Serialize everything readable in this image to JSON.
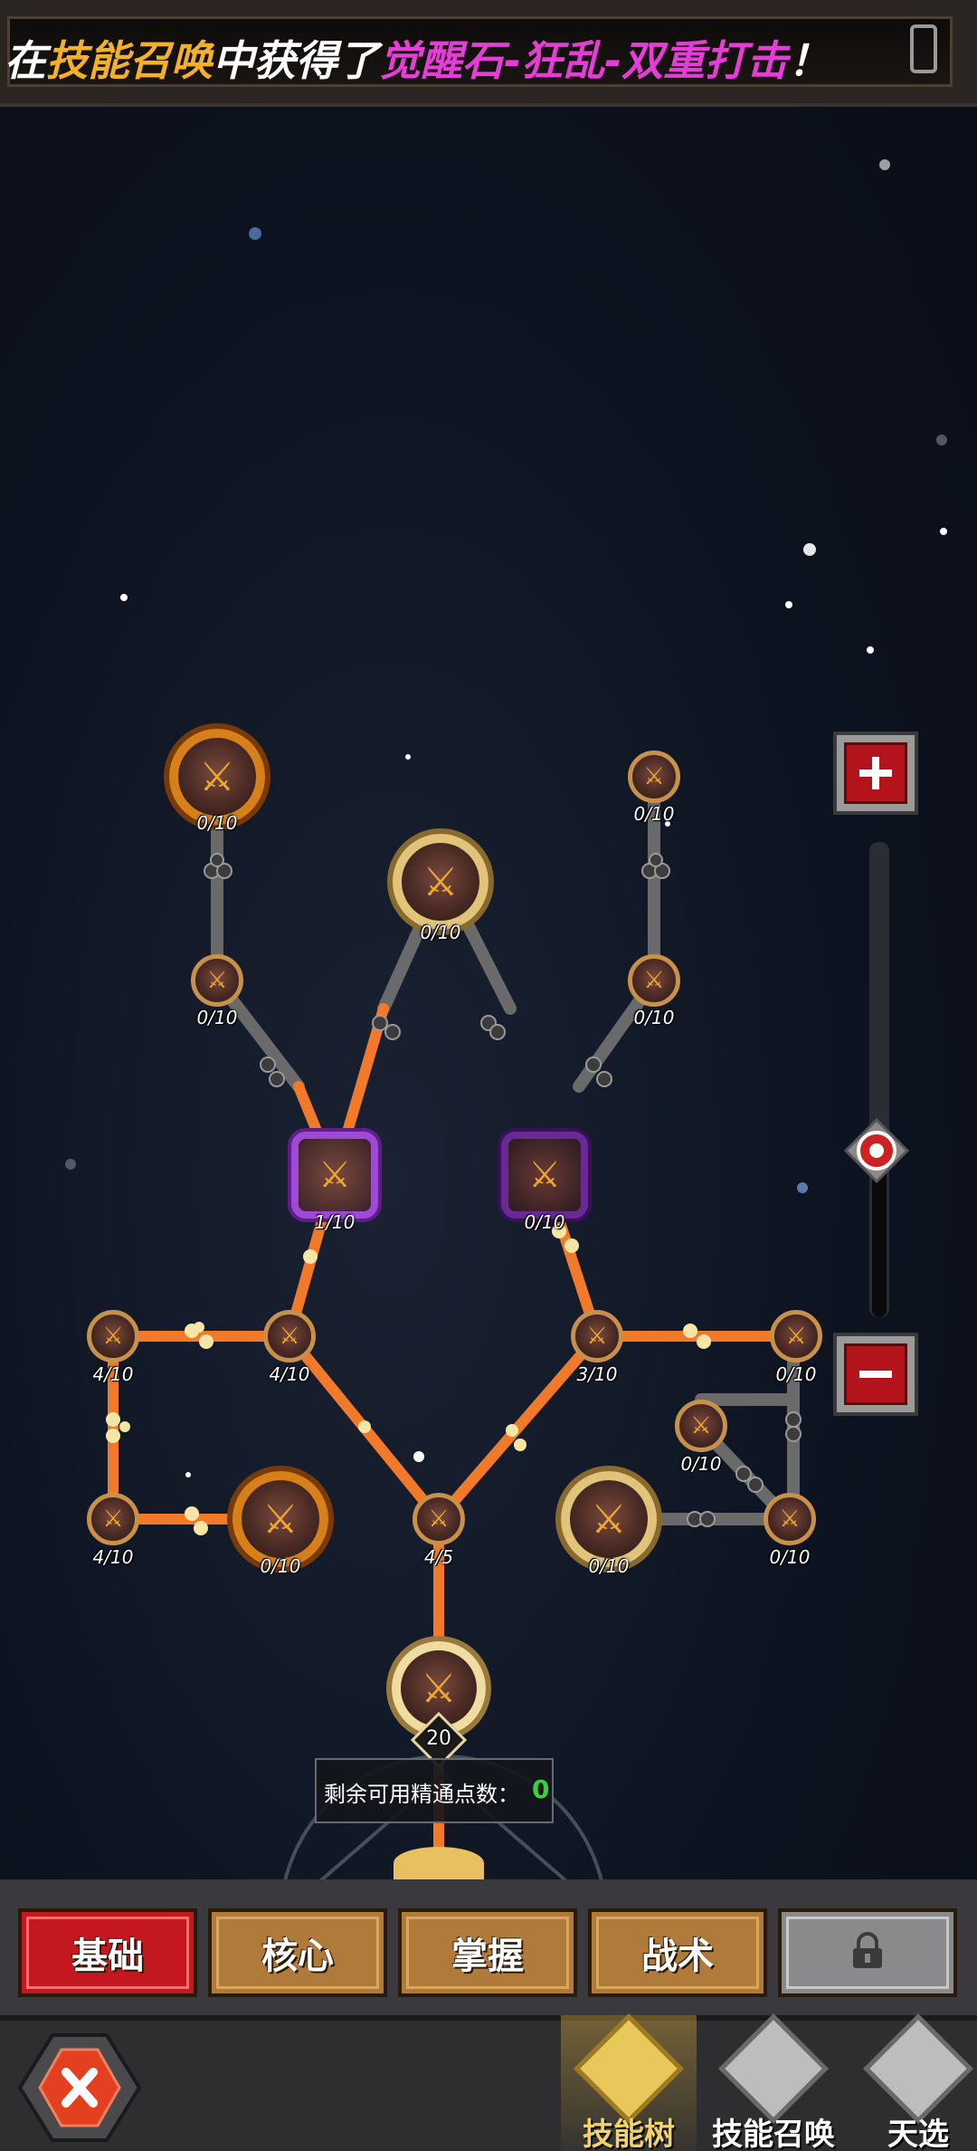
{
  "banner": {
    "parts": [
      {
        "text": "在",
        "color": "#ffffff"
      },
      {
        "text": "技能召唤",
        "color": "#f5b02a"
      },
      {
        "text": "中获得了",
        "color": "#ffffff"
      },
      {
        "text": "觉醒石-狂乱-双重打击",
        "color": "#e43ed6"
      },
      {
        "text": "！",
        "color": "#ffffff"
      }
    ]
  },
  "nodes": [
    {
      "id": "top-left-star",
      "label": "0/10"
    },
    {
      "id": "left-upper-small",
      "label": "0/10"
    },
    {
      "id": "top-center-gold",
      "label": "0/10"
    },
    {
      "id": "top-right-small",
      "label": "0/10"
    },
    {
      "id": "right-upper-small",
      "label": "0/10"
    },
    {
      "id": "purple-left",
      "label": "1/10"
    },
    {
      "id": "purple-right",
      "label": "0/10"
    },
    {
      "id": "left-far-mid",
      "label": "4/10"
    },
    {
      "id": "left-inner-mid",
      "label": "4/10"
    },
    {
      "id": "right-inner-mid",
      "label": "3/10"
    },
    {
      "id": "right-far-mid",
      "label": "0/10"
    },
    {
      "id": "right-branch-small",
      "label": "0/10"
    },
    {
      "id": "left-far-low",
      "label": "4/10"
    },
    {
      "id": "left-star-low",
      "label": "0/10"
    },
    {
      "id": "center-low",
      "label": "4/5"
    },
    {
      "id": "right-gold-low",
      "label": "0/10"
    },
    {
      "id": "right-far-low",
      "label": "0/10"
    },
    {
      "id": "root-node",
      "label": "20"
    }
  ],
  "points": {
    "label": "剩余可用精通点数：",
    "value": "0"
  },
  "tabs": [
    {
      "label": "基础",
      "active": true
    },
    {
      "label": "核心",
      "active": false
    },
    {
      "label": "掌握",
      "active": false
    },
    {
      "label": "战术",
      "active": false
    },
    {
      "label": "",
      "locked": true
    }
  ],
  "nav": [
    {
      "label": "技能树",
      "active": true
    },
    {
      "label": "技能召唤",
      "active": false
    },
    {
      "label": "天选",
      "active": false
    }
  ]
}
